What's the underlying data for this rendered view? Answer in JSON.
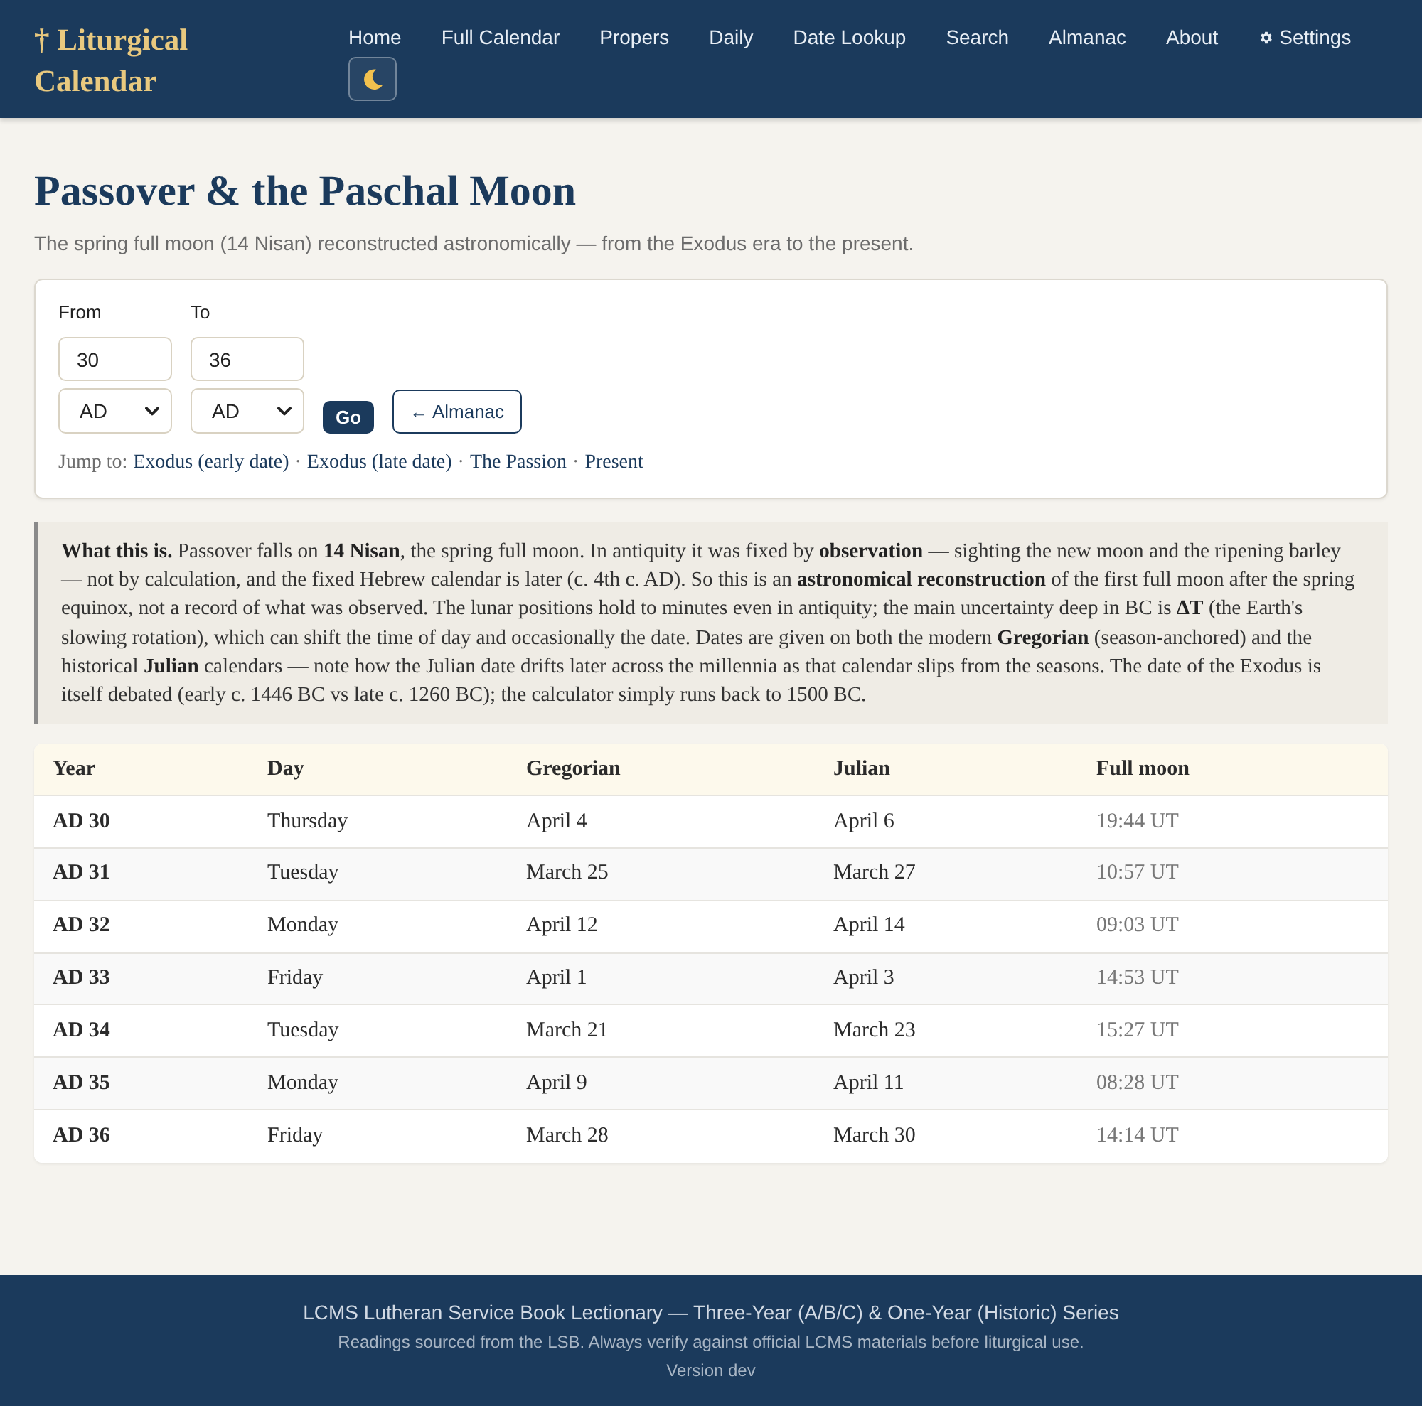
{
  "header": {
    "logo": "† Liturgical Calendar",
    "nav": [
      {
        "kind": "link",
        "label": "Home"
      },
      {
        "kind": "link",
        "label": "Full Calendar"
      },
      {
        "kind": "link",
        "label": "Propers"
      },
      {
        "kind": "link",
        "label": "Daily"
      },
      {
        "kind": "link",
        "label": "Date Lookup"
      },
      {
        "kind": "link",
        "label": "Search"
      },
      {
        "kind": "link",
        "label": "Almanac"
      },
      {
        "kind": "link",
        "label": "About"
      },
      {
        "kind": "settings",
        "label": "Settings"
      },
      {
        "kind": "theme-toggle"
      }
    ]
  },
  "page": {
    "title": "Passover & the Paschal Moon",
    "subtitle": "The spring full moon (14 Nisan) reconstructed astronomically — from the Exodus era to the present."
  },
  "range_form": {
    "fields": [
      {
        "label": "From",
        "value": "30",
        "era": "AD"
      },
      {
        "label": "To",
        "value": "36",
        "era": "AD"
      }
    ],
    "buttons": [
      {
        "kind": "primary",
        "label": "Go"
      },
      {
        "kind": "outline",
        "label": "← Almanac"
      }
    ],
    "jump_to": {
      "label": "Jump to:",
      "separator": "·",
      "links": [
        "Exodus (early date)",
        "Exodus (late date)",
        "The Passion",
        "Present"
      ]
    }
  },
  "note": "**What this is.** Passover falls on **14 Nisan**, the spring full moon. In antiquity it was fixed by **observation** — sighting the new moon and the ripening barley — not by calculation, and the fixed Hebrew calendar is later (c. 4th c. AD). So this is an **astronomical reconstruction** of the first full moon after the spring equinox, not a record of what was observed. The lunar positions hold to minutes even in antiquity; the main uncertainty deep in BC is **ΔT** (the Earth's slowing rotation), which can shift the time of day and occasionally the date. Dates are given on both the modern **Gregorian** (season-anchored) and the historical **Julian** calendars — note how the Julian date drifts later across the millennia as that calendar slips from the seasons. The date of the Exodus is itself debated (early c. 1446 BC vs late c. 1260 BC); the calculator simply runs back to 1500 BC.",
  "table": {
    "columns": [
      "Year",
      "Day",
      "Gregorian",
      "Julian",
      "Full moon"
    ],
    "rows": [
      [
        "AD 30",
        "Thursday",
        "April 4",
        "April 6",
        "19:44 UT"
      ],
      [
        "AD 31",
        "Tuesday",
        "March 25",
        "March 27",
        "10:57 UT"
      ],
      [
        "AD 32",
        "Monday",
        "April 12",
        "April 14",
        "09:03 UT"
      ],
      [
        "AD 33",
        "Friday",
        "April 1",
        "April 3",
        "14:53 UT"
      ],
      [
        "AD 34",
        "Tuesday",
        "March 21",
        "March 23",
        "15:27 UT"
      ],
      [
        "AD 35",
        "Monday",
        "April 9",
        "April 11",
        "08:28 UT"
      ],
      [
        "AD 36",
        "Friday",
        "March 28",
        "March 30",
        "14:14 UT"
      ]
    ]
  },
  "footer": [
    "LCMS Lutheran Service Book Lectionary — Three-Year (A/B/C) & One-Year (Historic) Series",
    "Readings sourced from the LSB. Always verify against official LCMS materials before liturgical use.",
    "Version dev"
  ]
}
